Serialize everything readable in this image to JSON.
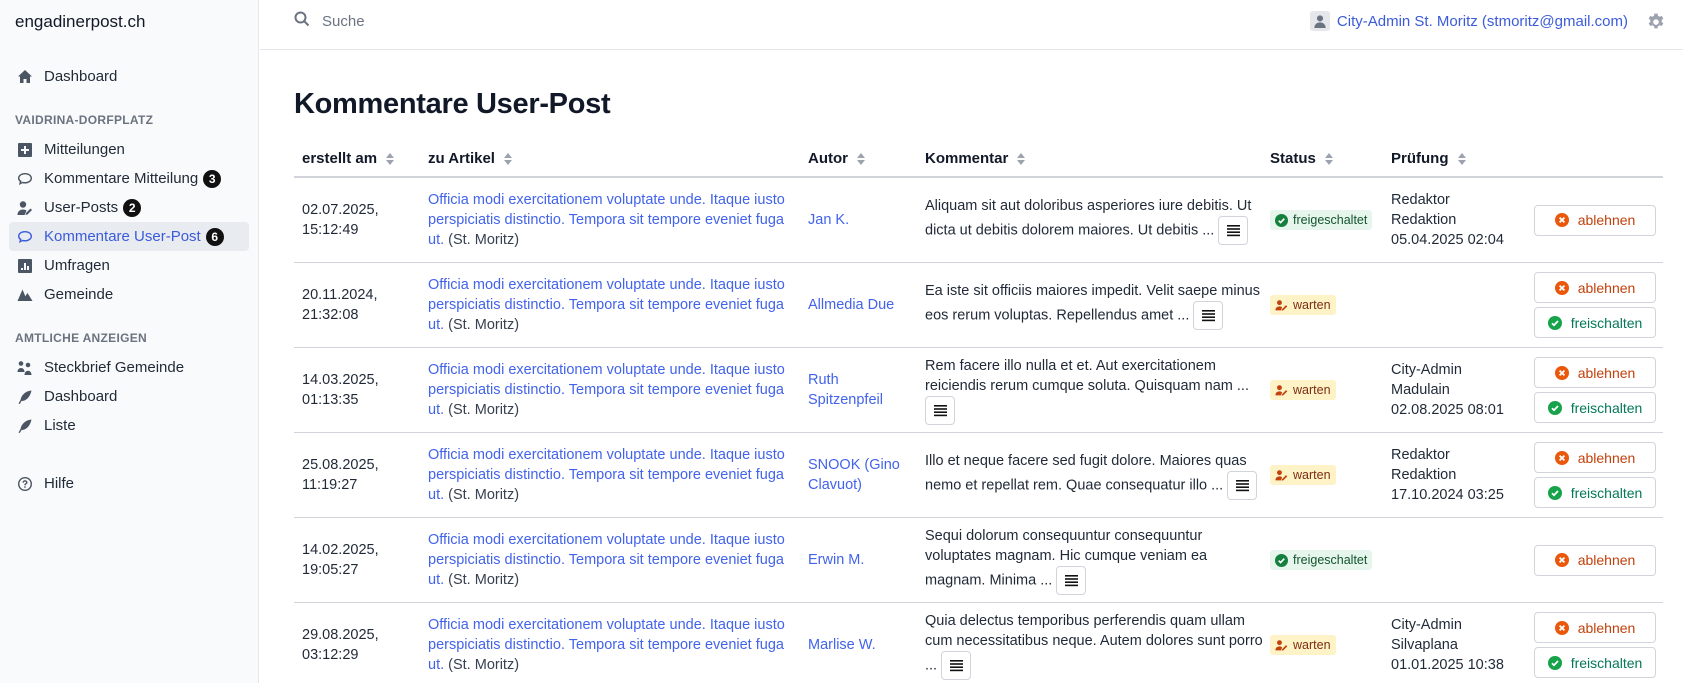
{
  "brand": "engadinerpost.ch",
  "nav": {
    "dashboard": "Dashboard",
    "section1": "VAIDRINA-DORFPLATZ",
    "mitteilungen": "Mitteilungen",
    "kommentare_mitteilung": "Kommentare Mitteilung",
    "kommentare_mitteilung_count": "3",
    "user_posts": "User-Posts",
    "user_posts_count": "2",
    "kommentare_user_post": "Kommentare User-Post",
    "kommentare_user_post_count": "6",
    "umfragen": "Umfragen",
    "gemeinde": "Gemeinde",
    "section2": "AMTLICHE ANZEIGEN",
    "steckbrief": "Steckbrief Gemeinde",
    "dashboard2": "Dashboard",
    "liste": "Liste",
    "hilfe": "Hilfe"
  },
  "search": {
    "placeholder": "Suche"
  },
  "user": {
    "label": "City-Admin St. Moritz (stmoritz@gmail.com)"
  },
  "page_title": "Kommentare User-Post",
  "columns": {
    "created": "erstellt am",
    "article": "zu Artikel",
    "author": "Autor",
    "comment": "Kommentar",
    "status": "Status",
    "review": "Prüfung"
  },
  "labels": {
    "reject": "ablehnen",
    "approve": "freischalten"
  },
  "colors": {
    "accent": "#4263eb",
    "reject": "#ea580c",
    "approve": "#16a34a",
    "approved_bg": "#e6f6ec",
    "wait_bg": "#fef3c7"
  },
  "rows": [
    {
      "date1": "02.07.2025,",
      "date2": "15:12:49",
      "article": "Officia modi exercitationem voluptate unde. Itaque iusto perspiciatis distinctio. Tempora sit tempore eveniet fuga ut.",
      "place": "(St. Moritz)",
      "author": "Jan K.",
      "comment": "Aliquam sit aut doloribus asperiores iure debitis. Ut dicta ut debitis dolorem maiores. Ut debitis ...",
      "status": "freigeschaltet",
      "status_type": "ok",
      "review1": "Redaktor",
      "review2": "Redaktion",
      "review3": "05.04.2025 02:04",
      "actions": [
        "reject"
      ]
    },
    {
      "date1": "20.11.2024,",
      "date2": "21:32:08",
      "article": "Officia modi exercitationem voluptate unde. Itaque iusto perspiciatis distinctio. Tempora sit tempore eveniet fuga ut.",
      "place": "(St. Moritz)",
      "author": "Allmedia Due",
      "comment": "Ea iste sit officiis maiores impedit. Velit saepe minus eos rerum voluptas. Repellendus amet ...",
      "status": "warten",
      "status_type": "wait",
      "review1": "",
      "review2": "",
      "review3": "",
      "actions": [
        "reject",
        "approve"
      ]
    },
    {
      "date1": "14.03.2025,",
      "date2": "01:13:35",
      "article": "Officia modi exercitationem voluptate unde. Itaque iusto perspiciatis distinctio. Tempora sit tempore eveniet fuga ut.",
      "place": "(St. Moritz)",
      "author": "Ruth Spitzenpfeil",
      "comment": "Rem facere illo nulla et et. Aut exercitationem reiciendis rerum cumque soluta. Quisquam nam ...",
      "status": "warten",
      "status_type": "wait",
      "review1": "City-Admin",
      "review2": "Madulain",
      "review3": "02.08.2025 08:01",
      "actions": [
        "reject",
        "approve"
      ]
    },
    {
      "date1": "25.08.2025,",
      "date2": "11:19:27",
      "article": "Officia modi exercitationem voluptate unde. Itaque iusto perspiciatis distinctio. Tempora sit tempore eveniet fuga ut.",
      "place": "(St. Moritz)",
      "author": "SNOOK (Gino Clavuot)",
      "comment": "Illo et neque facere sed fugit dolore. Maiores quas nemo et repellat rem. Quae consequatur illo ...",
      "status": "warten",
      "status_type": "wait",
      "review1": "Redaktor",
      "review2": "Redaktion",
      "review3": "17.10.2024 03:25",
      "actions": [
        "reject",
        "approve"
      ]
    },
    {
      "date1": "14.02.2025,",
      "date2": "19:05:27",
      "article": "Officia modi exercitationem voluptate unde. Itaque iusto perspiciatis distinctio. Tempora sit tempore eveniet fuga ut.",
      "place": "(St. Moritz)",
      "author": "Erwin M.",
      "comment": "Sequi dolorum consequuntur consequuntur voluptates magnam. Hic cumque veniam ea magnam. Minima ...",
      "status": "freigeschaltet",
      "status_type": "ok",
      "review1": "",
      "review2": "",
      "review3": "",
      "actions": [
        "reject"
      ]
    },
    {
      "date1": "29.08.2025,",
      "date2": "03:12:29",
      "article": "Officia modi exercitationem voluptate unde. Itaque iusto perspiciatis distinctio. Tempora sit tempore eveniet fuga ut.",
      "place": "(St. Moritz)",
      "author": "Marlise W.",
      "comment": "Quia delectus temporibus perferendis quam ullam cum necessitatibus neque. Autem dolores sunt porro ...",
      "status": "warten",
      "status_type": "wait",
      "review1": "City-Admin",
      "review2": "Silvaplana",
      "review3": "01.01.2025 10:38",
      "actions": [
        "reject",
        "approve"
      ]
    }
  ]
}
